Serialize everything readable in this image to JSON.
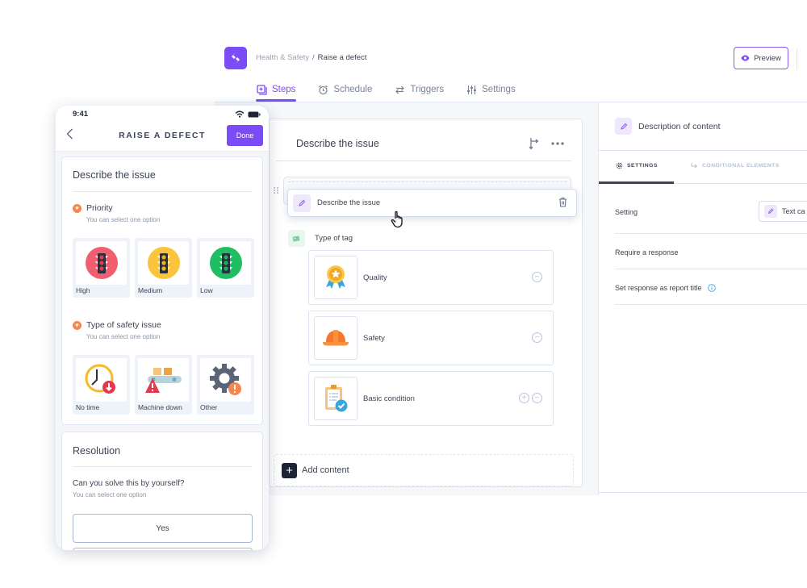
{
  "app": {
    "breadcrumb": {
      "parent": "Health & Safety",
      "separator": "/",
      "current": "Raise a defect"
    },
    "preview_label": "Preview",
    "accent_color": "#7b4cf5",
    "tabs": [
      {
        "label": "Steps",
        "icon": "steps-icon",
        "active": true
      },
      {
        "label": "Schedule",
        "icon": "alarm-clock-icon",
        "active": false
      },
      {
        "label": "Triggers",
        "icon": "arrows-swap-icon",
        "active": false
      },
      {
        "label": "Settings",
        "icon": "sliders-icon",
        "active": false
      }
    ]
  },
  "step": {
    "title": "Describe the issue",
    "dragging_item": {
      "label": "Describe the issue",
      "icon": "pencil-icon"
    },
    "tag_field": {
      "label": "Type of tag",
      "icon": "tag-icon"
    },
    "options": [
      {
        "label": "Quality",
        "icon": "award-ribbon-icon",
        "controls": [
          "remove"
        ]
      },
      {
        "label": "Safety",
        "icon": "hard-hat-icon",
        "controls": [
          "remove"
        ]
      },
      {
        "label": "Basic condition",
        "icon": "clipboard-check-icon",
        "controls": [
          "add",
          "remove"
        ]
      }
    ],
    "add_content_label": "Add content"
  },
  "panel": {
    "title": "Description of content",
    "tabs": [
      {
        "label": "SETTINGS",
        "active": true
      },
      {
        "label": "CONDITIONAL ELEMENTS",
        "active": false
      }
    ],
    "rows": [
      {
        "label": "Setting",
        "control_label": "Text ca"
      },
      {
        "label": "Require a response"
      },
      {
        "label": "Set response as report title",
        "has_info": true
      }
    ]
  },
  "phone": {
    "time": "9:41",
    "title": "RAISE A DEFECT",
    "done_label": "Done",
    "section1": {
      "title": "Describe the issue",
      "questions": [
        {
          "title": "Priority",
          "subtitle": "You can select one option",
          "options": [
            {
              "label": "High",
              "icon": "traffic-light-red-icon"
            },
            {
              "label": "Medium",
              "icon": "traffic-light-yellow-icon"
            },
            {
              "label": "Low",
              "icon": "traffic-light-green-icon"
            }
          ]
        },
        {
          "title": "Type of safety issue",
          "subtitle": "You can select one option",
          "options": [
            {
              "label": "No time",
              "icon": "clock-alert-icon"
            },
            {
              "label": "Machine down",
              "icon": "conveyor-warning-icon"
            },
            {
              "label": "Other",
              "icon": "gear-alert-icon"
            }
          ]
        }
      ]
    },
    "section2": {
      "title": "Resolution",
      "question": "Can you solve this by yourself?",
      "subtitle": "You can select one option",
      "options": [
        "Yes"
      ]
    }
  }
}
